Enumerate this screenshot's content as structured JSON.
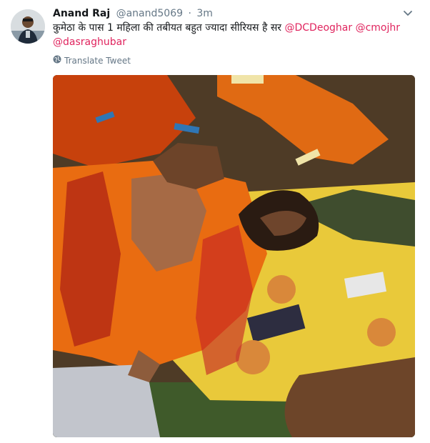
{
  "tweet": {
    "author_name": "Anand Raj",
    "handle": "@anand5069",
    "separator": "·",
    "time": "3m",
    "body_text": "कुमेठा के पास 1 महिला की तबीयत बहुत ज्यादा सीरियस है सर",
    "mentions": [
      "@DCDeoghar",
      "@cmojhr",
      "@dasraghubar"
    ],
    "translate_label": "Translate Tweet"
  },
  "icons": {
    "globe": "globe-icon",
    "chevron": "chevron-down-icon"
  },
  "colors": {
    "link": "#e0245e",
    "muted": "#657786",
    "text": "#14171a"
  }
}
